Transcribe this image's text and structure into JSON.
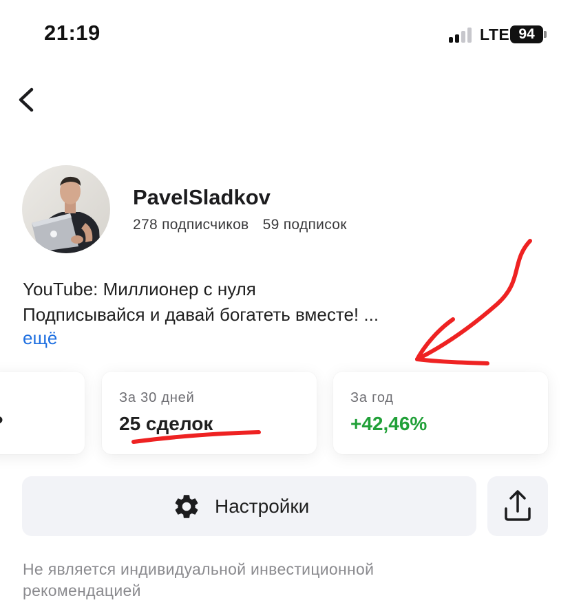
{
  "status_bar": {
    "time": "21:19",
    "network": "LTE",
    "battery": "94"
  },
  "profile": {
    "username": "PavelSladkov",
    "followers": "278 подписчиков",
    "following": "59 подписок",
    "bio_line_1": "YouTube: Миллионер с нуля",
    "bio_line_2": "Подписывайся и давай богатеть вместе! ...",
    "more_link": "ещё"
  },
  "stats": [
    {
      "label": "",
      "value": "?"
    },
    {
      "label": "За 30 дней",
      "value": "25 сделок"
    },
    {
      "label": "За год",
      "value": "+42,46%"
    }
  ],
  "actions": {
    "settings_label": "Настройки"
  },
  "disclaimer": "Не является индивидуальной инвестиционной рекомендацией",
  "colors": {
    "accent_link": "#1e6fe0",
    "positive": "#21a038",
    "annotation_red": "#ee2222",
    "button_bg": "#f2f3f7"
  },
  "icons": {
    "back": "chevron-left-icon",
    "settings": "gear-icon",
    "share": "share-upload-icon"
  }
}
